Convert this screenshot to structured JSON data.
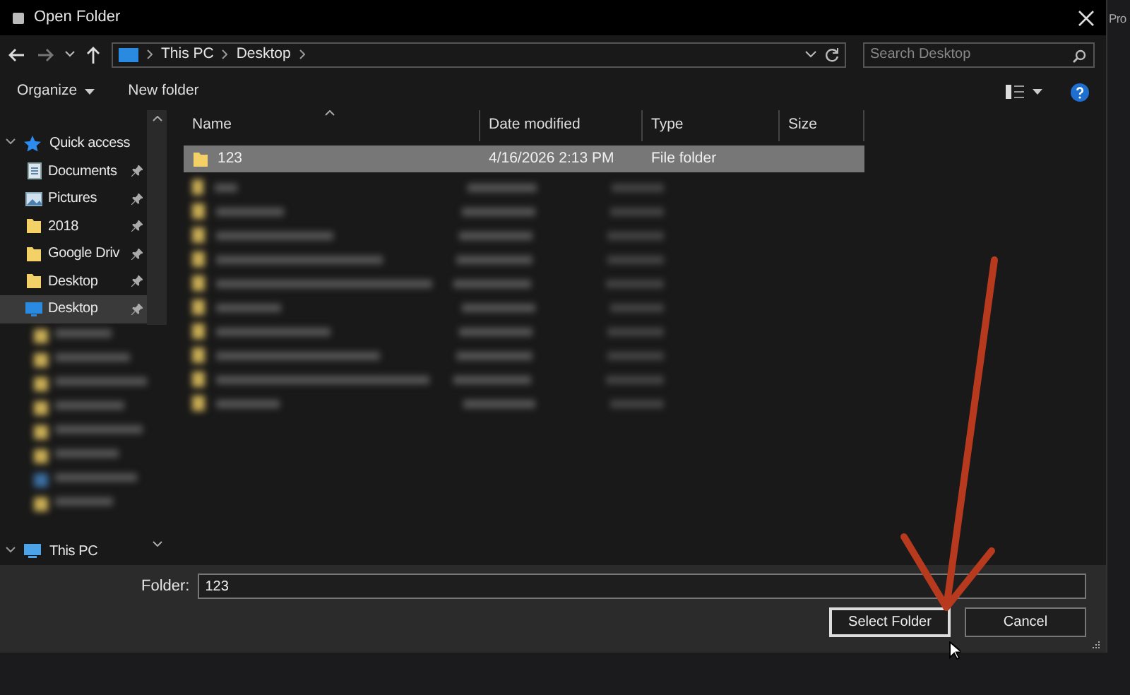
{
  "window": {
    "title": "Open Folder"
  },
  "background_text": "Pro",
  "breadcrumb": [
    "This PC",
    "Desktop"
  ],
  "search": {
    "placeholder": "Search Desktop"
  },
  "toolbar": [
    {
      "label": "Organize",
      "dropdown": true
    },
    {
      "label": "New folder",
      "dropdown": false
    }
  ],
  "sidebar": {
    "items": [
      {
        "label": "Quick access",
        "kind": "star",
        "expanded": true,
        "selected": false,
        "children": [
          {
            "label": "Documents",
            "kind": "documents",
            "pinned": true,
            "selected": false
          },
          {
            "label": "Pictures",
            "kind": "pictures",
            "pinned": true,
            "selected": false
          },
          {
            "label": "2018",
            "kind": "folder",
            "pinned": true,
            "selected": false
          },
          {
            "label": "Google Driv",
            "kind": "folder",
            "pinned": true,
            "selected": false
          },
          {
            "label": "Desktop",
            "kind": "folder",
            "pinned": true,
            "selected": false
          },
          {
            "label": "Desktop",
            "kind": "desktop",
            "pinned": true,
            "selected": true
          }
        ]
      },
      {
        "label": "This PC",
        "kind": "pc",
        "expanded": true,
        "selected": false
      }
    ]
  },
  "table": {
    "columns": [
      "Name",
      "Date modified",
      "Type",
      "Size"
    ],
    "rows": [
      {
        "name": "123",
        "date_modified": "4/16/2026 2:13 PM",
        "type": "File folder",
        "selected": true
      }
    ]
  },
  "folder_field": {
    "label": "Folder:",
    "value": "123"
  },
  "buttons": [
    {
      "label": "Select Folder",
      "default": true
    },
    {
      "label": "Cancel",
      "default": false
    }
  ]
}
